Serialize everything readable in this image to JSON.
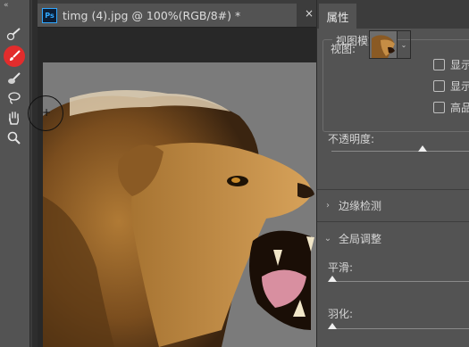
{
  "toolbar": {
    "collapse_glyph": "«"
  },
  "tools": [
    {
      "icon": "quick-selection-icon",
      "active": false
    },
    {
      "icon": "brush-icon",
      "active": true
    },
    {
      "icon": "eraser-brush-icon",
      "active": false
    },
    {
      "icon": "lasso-icon",
      "active": false
    },
    {
      "icon": "hand-icon",
      "active": false
    },
    {
      "icon": "zoom-icon",
      "active": false
    }
  ],
  "document": {
    "app_badge": "Ps",
    "tab_title": "timg (4).jpg @ 100%(RGB/8#) *",
    "close_glyph": "×",
    "minimize_glyph": "−"
  },
  "properties": {
    "tab_label": "属性",
    "view_mode": {
      "title": "视图模式",
      "view_label": "视图:",
      "checkboxes": [
        {
          "label": "显示",
          "checked": false
        },
        {
          "label": "显示",
          "checked": false
        },
        {
          "label": "高品",
          "checked": false
        }
      ]
    },
    "opacity_label": "不透明度:",
    "edge_detection_label": "边缘检测",
    "global_refine_label": "全局调整",
    "smooth_label": "平滑:",
    "feather_label": "羽化:"
  },
  "colors": {
    "accent_tool": "#e22c2c",
    "ps_badge": "#31a8ff"
  }
}
